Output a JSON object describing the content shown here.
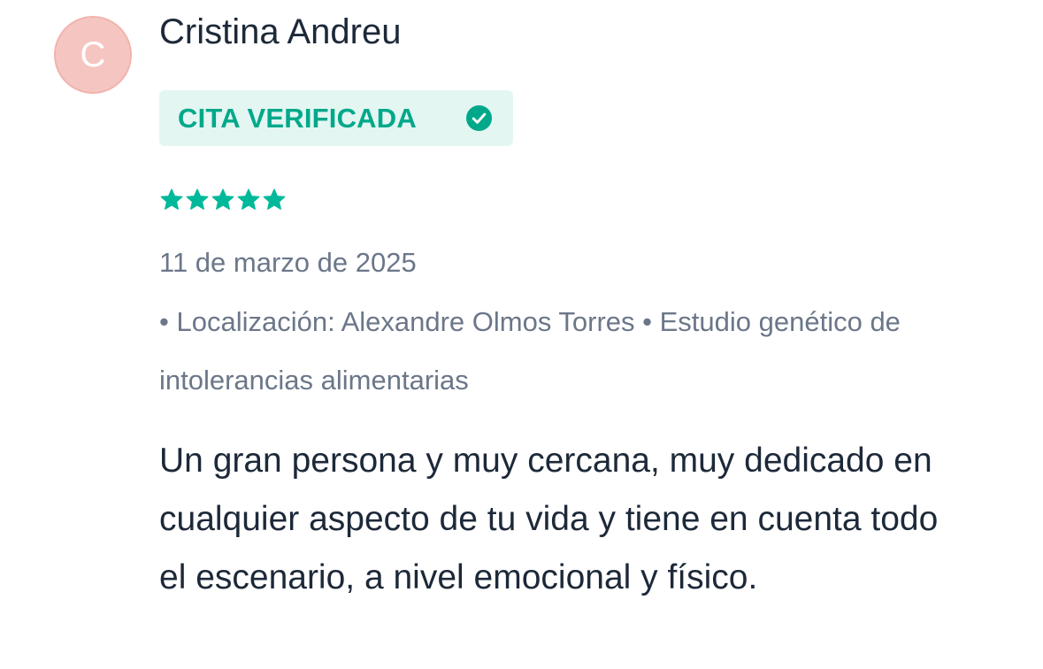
{
  "review": {
    "avatar_initial": "C",
    "author_name": "Cristina Andreu",
    "badge_label": "CITA VERIFICADA",
    "rating": 5,
    "rating_max": 5,
    "date": "11 de marzo de 2025",
    "meta_text": "• Localización: Alexandre Olmos Torres • Estudio genético de intolerancias alimentarias",
    "text": "Un gran persona y muy cercana, muy dedicado en cualquier aspecto de tu vida y tiene en cuenta todo el escenario, a nivel emocional y físico."
  },
  "colors": {
    "accent": "#00b99a",
    "badge_background": "#e3f6f2",
    "badge_text": "#00a88a",
    "avatar_background": "#f5c6c1",
    "primary_text": "#1d2939",
    "secondary_text": "#6b7789"
  },
  "icons": {
    "badge_icon": "check-circle-icon",
    "rating_icon": "star-icon"
  }
}
